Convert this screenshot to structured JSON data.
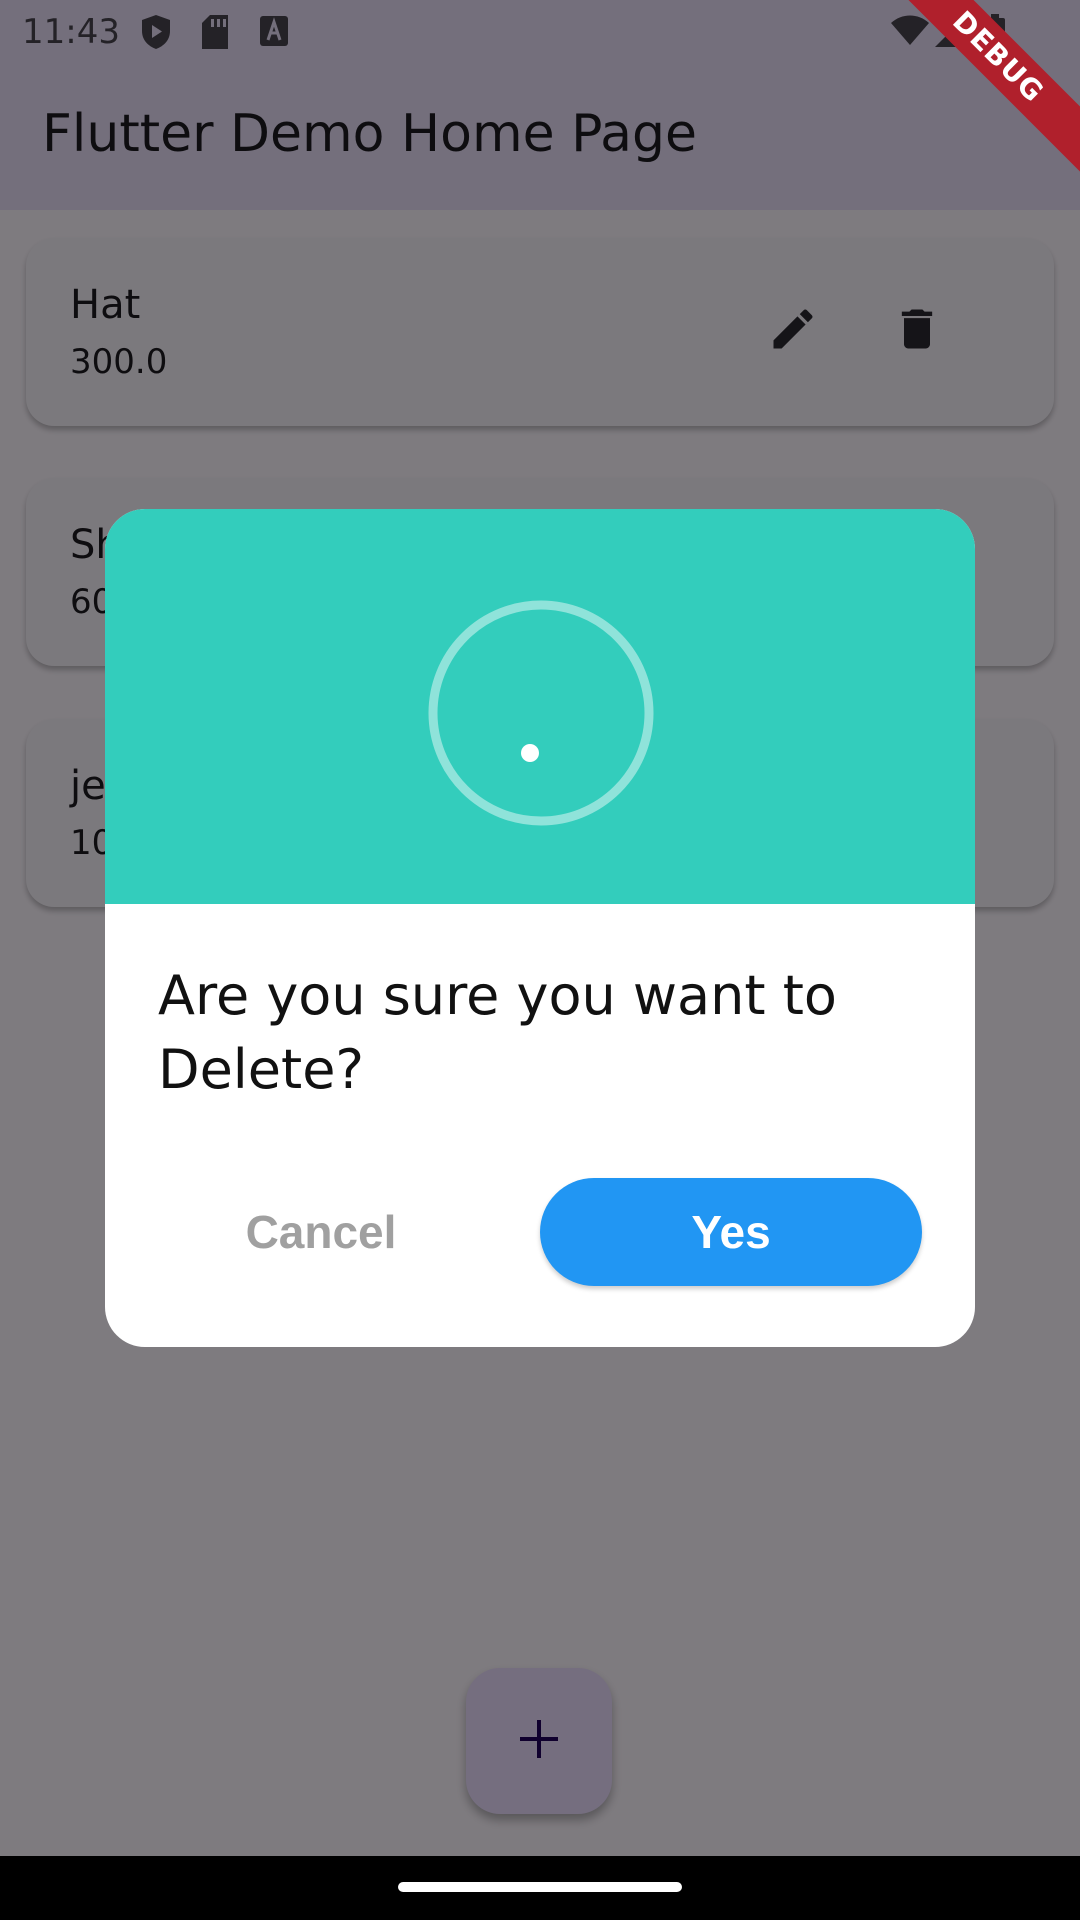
{
  "status_bar": {
    "time": "11:43",
    "left_icons": [
      "play-protect-icon",
      "sd-card-icon",
      "keyboard-a-icon"
    ],
    "right_icons": [
      "wifi-icon",
      "cell-signal-icon",
      "battery-icon"
    ]
  },
  "app_bar": {
    "title": "Flutter Demo Home Page"
  },
  "debug_banner": "DEBUG",
  "items": [
    {
      "name": "Hat",
      "price": "300.0"
    },
    {
      "name": "Sh",
      "price": "60"
    },
    {
      "name": "je",
      "price": "10"
    }
  ],
  "item_actions": [
    "edit-icon",
    "delete-icon"
  ],
  "dialog": {
    "message": "Are you sure you want to Delete?",
    "cancel_label": "Cancel",
    "confirm_label": "Yes",
    "header_color": "#33cdbc",
    "confirm_color": "#2196f3"
  },
  "fab": {
    "icon": "add-icon",
    "label": "+"
  },
  "colors": {
    "app_bar": "#e8def8",
    "card": "#f7f2fa",
    "fab": "#eaddff",
    "debug": "#b0202c"
  }
}
